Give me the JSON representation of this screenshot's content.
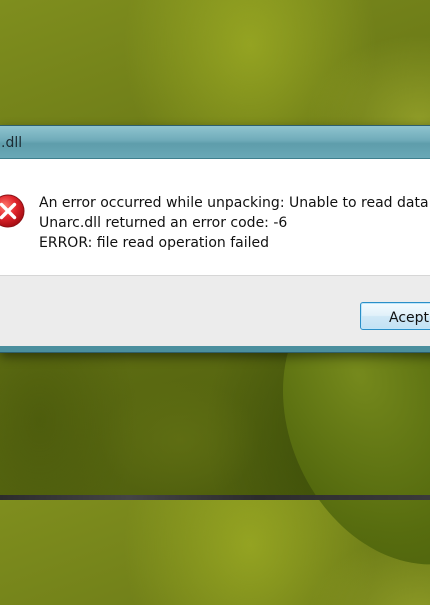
{
  "window": {
    "title": ".dll"
  },
  "message": {
    "line1": "An error occurred while unpacking: Unable to read data",
    "line2": "Unarc.dll returned an error code: -6",
    "line3": "ERROR: file read operation failed"
  },
  "buttons": {
    "accept_label": "Acept"
  },
  "icons": {
    "error": "error-x-icon"
  },
  "colors": {
    "error_red": "#d9222a",
    "titlebar": "#6fabb9",
    "button_border": "#2a8fc7"
  }
}
